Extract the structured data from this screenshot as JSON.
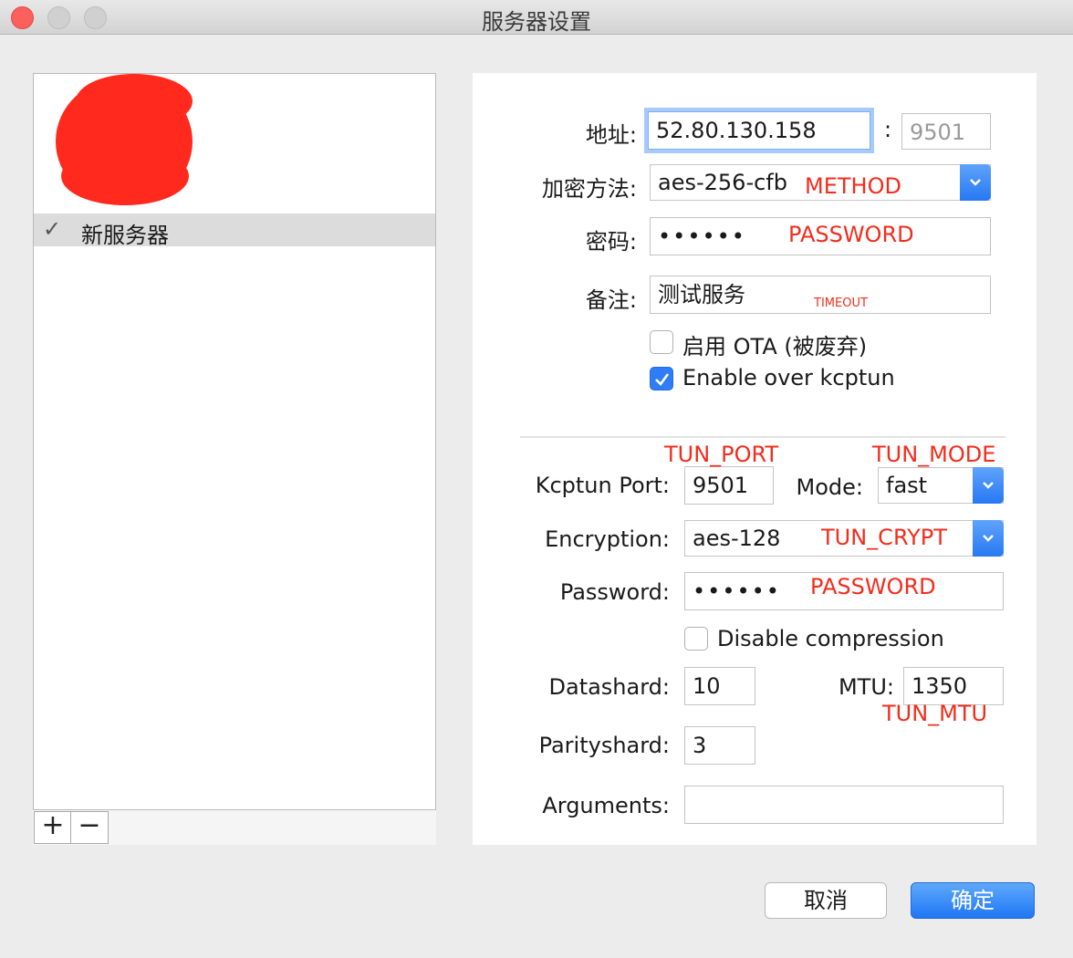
{
  "window": {
    "title": "服务器设置"
  },
  "server_list": {
    "items": [
      {
        "label": "新服务器",
        "selected": true
      }
    ],
    "add_label": "+",
    "remove_label": "−"
  },
  "server": {
    "address_label": "地址:",
    "address_value": "52.80.130.158",
    "port_sep": ":",
    "port_value": "9501",
    "method_label": "加密方法:",
    "method_value": "aes-256-cfb",
    "password_label": "密码:",
    "password_value": "••••••",
    "remark_label": "备注:",
    "remark_value": "测试服务",
    "ota_label": "启用 OTA (被废弃)",
    "ota_checked": false,
    "kcptun_label": "Enable over kcptun",
    "kcptun_checked": true
  },
  "kcptun": {
    "port_label": "Kcptun Port:",
    "port_value": "9501",
    "mode_label": "Mode:",
    "mode_value": "fast",
    "encryption_label": "Encryption:",
    "encryption_value": "aes-128",
    "password_label": "Password:",
    "password_value": "••••••",
    "nocomp_label": "Disable compression",
    "nocomp_checked": false,
    "datashard_label": "Datashard:",
    "datashard_value": "10",
    "mtu_label": "MTU:",
    "mtu_value": "1350",
    "parityshard_label": "Parityshard:",
    "parityshard_value": "3",
    "arguments_label": "Arguments:",
    "arguments_value": ""
  },
  "annotations": {
    "method": "METHOD",
    "password": "PASSWORD",
    "timeout": "TIMEOUT",
    "tun_port": "TUN_PORT",
    "tun_mode": "TUN_MODE",
    "tun_crypt": "TUN_CRYPT",
    "tun_password": "PASSWORD",
    "tun_mtu": "TUN_MTU"
  },
  "buttons": {
    "cancel": "取消",
    "ok": "确定"
  },
  "colors": {
    "accent": "#2e7cf6",
    "annotation": "#f32c1c",
    "redaction": "#ff2a1d"
  }
}
